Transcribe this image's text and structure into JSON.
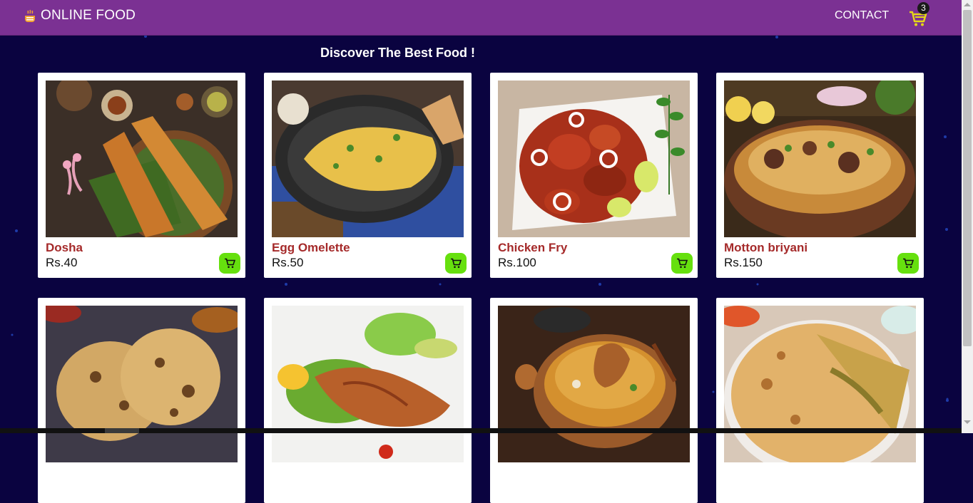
{
  "navbar": {
    "brand": "ONLINE FOOD",
    "contact_label": "CONTACT",
    "cart_count": "3",
    "brand_icon": "food-bowl-icon",
    "cart_icon": "shopping-cart-icon",
    "colors": {
      "background": "#7b3193",
      "cart_icon": "#e5d817"
    }
  },
  "main": {
    "headline": "Discover The Best Food !",
    "background": "#0a0340",
    "add_to_cart_color": "#66e00e",
    "items": [
      {
        "name": "Dosha",
        "price": "Rs.40"
      },
      {
        "name": "Egg Omelette",
        "price": "Rs.50"
      },
      {
        "name": "Chicken Fry",
        "price": "Rs.100"
      },
      {
        "name": "Motton briyani",
        "price": "Rs.150"
      },
      {
        "name": "",
        "price": ""
      },
      {
        "name": "",
        "price": ""
      },
      {
        "name": "",
        "price": ""
      },
      {
        "name": "",
        "price": ""
      }
    ]
  }
}
